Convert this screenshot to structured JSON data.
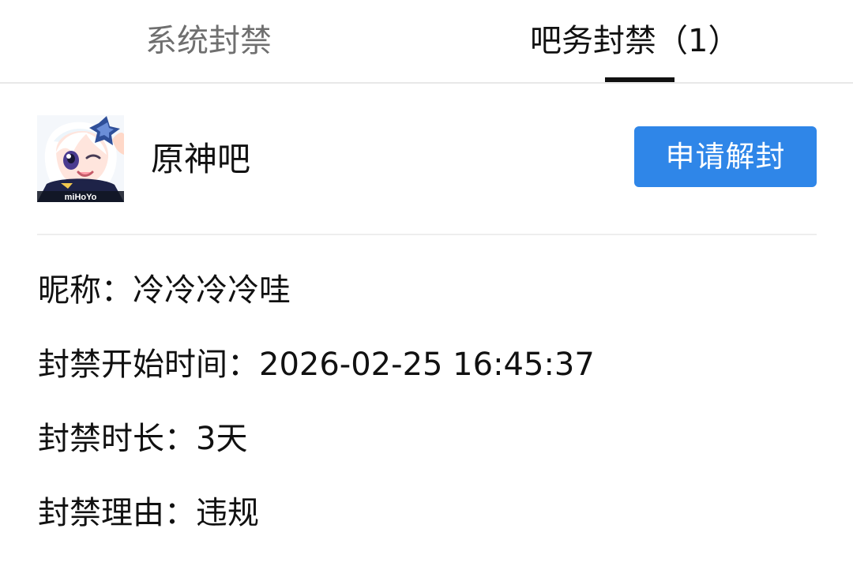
{
  "tabs": {
    "system_label": "系统封禁",
    "bar_label": "吧务封禁（1）",
    "active": "bar"
  },
  "forum": {
    "name": "原神吧",
    "avatar_icon": "paimon-avatar-icon",
    "avatar_watermark": "miHoYo",
    "appeal_button_label": "申请解封"
  },
  "ban_details": {
    "nickname_label": "昵称：",
    "nickname_value": "冷冷冷冷哇",
    "start_label": "封禁开始时间：",
    "start_value": "2026-02-25 16:45:37",
    "duration_label": "封禁时长：",
    "duration_value": "3天",
    "reason_label": "封禁理由：",
    "reason_value": "违规"
  },
  "colors": {
    "accent": "#2f86e8",
    "active_text": "#111111",
    "inactive_text": "#6f6f6f",
    "divider": "#eeeeee"
  }
}
